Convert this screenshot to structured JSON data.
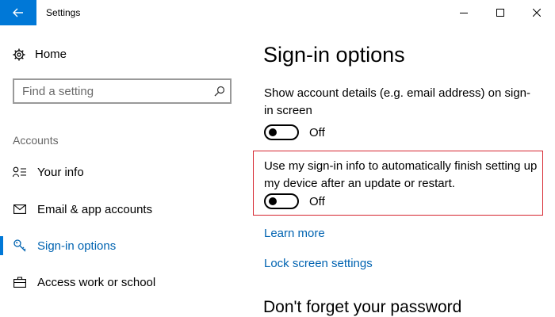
{
  "window": {
    "title": "Settings",
    "colors": {
      "accent": "#0078d7",
      "link": "#0063b1",
      "highlight_border": "#d6252f"
    }
  },
  "sidebar": {
    "home_label": "Home",
    "search_placeholder": "Find a setting",
    "section_label": "Accounts",
    "items": [
      {
        "label": "Your info",
        "icon": "person-list-icon",
        "active": false
      },
      {
        "label": "Email & app accounts",
        "icon": "envelope-icon",
        "active": false
      },
      {
        "label": "Sign-in options",
        "icon": "key-icon",
        "active": true
      },
      {
        "label": "Access work or school",
        "icon": "briefcase-icon",
        "active": false
      }
    ]
  },
  "main": {
    "title": "Sign-in options",
    "settings": [
      {
        "description": "Show account details (e.g. email address) on sign-in screen",
        "state": "Off"
      },
      {
        "description": "Use my sign-in info to automatically finish setting up my device after an update or restart.",
        "state": "Off"
      }
    ],
    "links": [
      "Learn more",
      "Lock screen settings"
    ],
    "next_heading": "Don't forget your password"
  }
}
